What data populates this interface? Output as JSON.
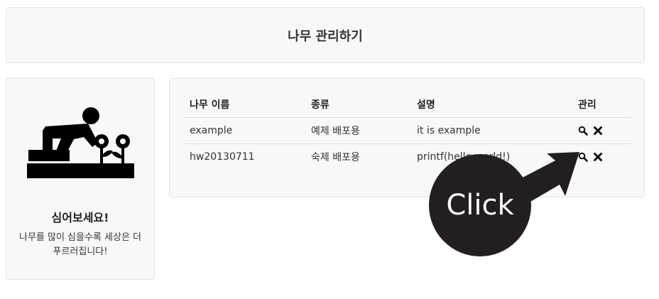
{
  "header": {
    "title": "나무 관리하기"
  },
  "sidebar": {
    "icon": "gardener-planting-flowers-icon",
    "title": "심어보세요!",
    "description": "나무를 많이 심을수록 세상은 더 푸르러집니다!"
  },
  "table": {
    "columns": [
      "나무 이름",
      "종류",
      "설명",
      "관리"
    ],
    "rows": [
      {
        "name": "example",
        "kind": "예제 배포용",
        "description": "it is example"
      },
      {
        "name": "hw20130711",
        "kind": "숙제 배포용",
        "description": "printf(hello world!)"
      }
    ],
    "row_actions": [
      "search-icon",
      "remove-icon"
    ]
  },
  "callout": {
    "label": "Click",
    "color": "#231f20"
  }
}
